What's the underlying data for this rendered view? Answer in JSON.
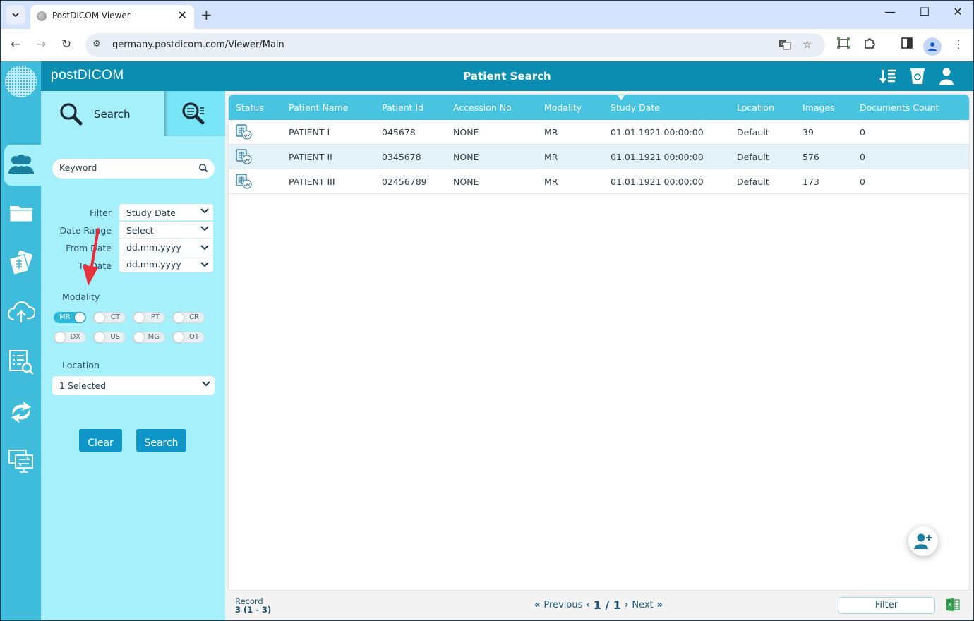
{
  "browser": {
    "tab_title": "PostDICOM Viewer",
    "url": "germany.postdicom.com/Viewer/Main",
    "icons": [
      "tab-search-icon",
      "back-icon",
      "forward-icon",
      "reload-icon",
      "site-info-icon",
      "translate-icon",
      "bookmark-star-icon",
      "screenshot-icon",
      "extensions-icon",
      "side-panel-icon",
      "profile-icon",
      "menu-icon",
      "minimize-icon",
      "maximize-icon",
      "close-icon"
    ]
  },
  "app": {
    "brand": "postDICOM",
    "page_title": "Patient Search",
    "header_icons": [
      "sort-list-icon",
      "recycle-bin-icon",
      "user-icon"
    ],
    "left_nav": [
      {
        "name": "patients",
        "icon": "users-icon",
        "active": true
      },
      {
        "name": "folders",
        "icon": "folder-icon",
        "active": false
      },
      {
        "name": "studies",
        "icon": "cards-icon",
        "active": false
      },
      {
        "name": "upload",
        "icon": "cloud-upload-icon",
        "active": false
      },
      {
        "name": "search-list",
        "icon": "list-search-icon",
        "active": false
      },
      {
        "name": "sync",
        "icon": "sync-icon",
        "active": false
      },
      {
        "name": "transfer",
        "icon": "monitor-transfer-icon",
        "active": false
      }
    ]
  },
  "search_panel": {
    "tab_search_label": "Search",
    "keyword_placeholder": "Keyword",
    "filters": [
      {
        "label": "Filter",
        "value": "Study Date"
      },
      {
        "label": "Date Range",
        "value": "Select"
      },
      {
        "label": "From Date",
        "value": "dd.mm.yyyy"
      },
      {
        "label": "To Date",
        "value": "dd.mm.yyyy"
      }
    ],
    "modality_label": "Modality",
    "modalities": [
      {
        "label": "MR",
        "on": true
      },
      {
        "label": "CT",
        "on": false
      },
      {
        "label": "PT",
        "on": false
      },
      {
        "label": "CR",
        "on": false
      },
      {
        "label": "DX",
        "on": false
      },
      {
        "label": "US",
        "on": false
      },
      {
        "label": "MG",
        "on": false
      },
      {
        "label": "OT",
        "on": false
      }
    ],
    "location_label": "Location",
    "location_value": "1 Selected",
    "clear_label": "Clear",
    "search_label": "Search"
  },
  "grid": {
    "columns": [
      "Status",
      "Patient Name",
      "Patient Id",
      "Accession No",
      "Modality",
      "Study Date",
      "Location",
      "Images",
      "Documents Count"
    ],
    "sorted_column": "Study Date",
    "rows": [
      {
        "status": "report-icon",
        "patient_name": "PATIENT I",
        "patient_id": "045678",
        "accession_no": "NONE",
        "modality": "MR",
        "study_date": "01.01.1921 00:00:00",
        "location": "Default",
        "images": "39",
        "documents_count": "0"
      },
      {
        "status": "report-icon",
        "patient_name": "PATIENT II",
        "patient_id": "0345678",
        "accession_no": "NONE",
        "modality": "MR",
        "study_date": "01.01.1921 00:00:00",
        "location": "Default",
        "images": "576",
        "documents_count": "0"
      },
      {
        "status": "report-icon",
        "patient_name": "PATIENT III",
        "patient_id": "02456789",
        "accession_no": "NONE",
        "modality": "MR",
        "study_date": "01.01.1921 00:00:00",
        "location": "Default",
        "images": "173",
        "documents_count": "0"
      }
    ]
  },
  "footer": {
    "record_label": "Record",
    "record_value": "3 (1 - 3)",
    "previous_label": "Previous",
    "next_label": "Next",
    "page_indicator": "1 / 1",
    "filter_label": "Filter"
  },
  "colors": {
    "header": "#0a8db0",
    "left_nav": "#3fbcdc",
    "panel": "#a6f0fb",
    "grid_header": "#48c3e0",
    "button": "#0f96c8",
    "annotation_arrow": "#e8303a"
  }
}
